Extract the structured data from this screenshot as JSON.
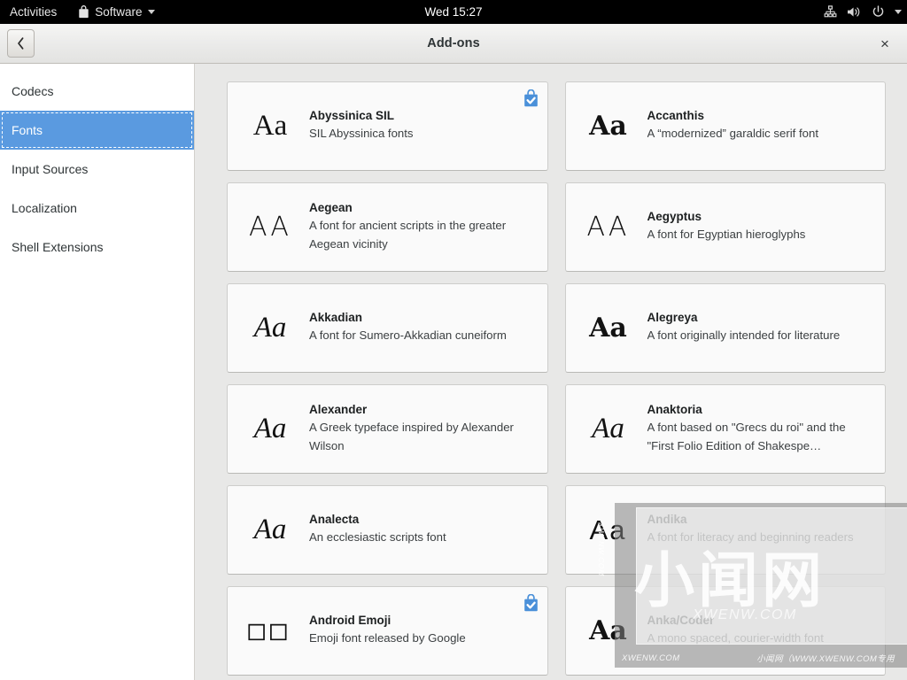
{
  "topbar": {
    "activities": "Activities",
    "app_name": "Software",
    "app_icon": "shopping-bag-icon",
    "clock": "Wed 15:27",
    "status_icons": [
      "network-wired-icon",
      "volume-icon",
      "power-icon",
      "chevron-down-icon"
    ]
  },
  "window": {
    "title": "Add-ons",
    "back_icon": "chevron-left-icon",
    "back_glyph": "‹",
    "close_icon": "close-icon",
    "close_glyph": "×"
  },
  "sidebar": {
    "selected": "Fonts",
    "items": [
      {
        "label": "Codecs"
      },
      {
        "label": "Fonts"
      },
      {
        "label": "Input Sources"
      },
      {
        "label": "Localization"
      },
      {
        "label": "Shell Extensions"
      }
    ]
  },
  "cards": [
    {
      "title": "Abyssinica SIL",
      "desc": "SIL Abyssinica fonts",
      "preview": "Aa",
      "style": "pv-serif",
      "installed": true
    },
    {
      "title": "Accanthis",
      "desc": "A “modernized” garaldic serif font",
      "preview": "Aa",
      "style": "pv-bold",
      "installed": false
    },
    {
      "title": "Aegean",
      "desc": "A font for ancient scripts in the greater Aegean vicinity",
      "preview": "AA",
      "style": "pv-sansthin",
      "installed": false
    },
    {
      "title": "Aegyptus",
      "desc": "A font for Egyptian hieroglyphs",
      "preview": "AA",
      "style": "pv-sansthin",
      "installed": false
    },
    {
      "title": "Akkadian",
      "desc": "A font for Sumero-Akkadian cuneiform",
      "preview": "Aa",
      "style": "pv-italic",
      "installed": false
    },
    {
      "title": "Alegreya",
      "desc": "A font originally intended for literature",
      "preview": "Aa",
      "style": "pv-bold",
      "installed": false
    },
    {
      "title": "Alexander",
      "desc": "A Greek typeface inspired by Alexander Wilson",
      "preview": "Aa",
      "style": "pv-italic",
      "installed": false
    },
    {
      "title": "Anaktoria",
      "desc": "A font based on \"Grecs du roi\" and the \"First Folio Edition of Shakespe…",
      "preview": "Aa",
      "style": "pv-italic",
      "installed": false
    },
    {
      "title": "Analecta",
      "desc": "An ecclesiastic scripts font",
      "preview": "Aa",
      "style": "pv-italic",
      "installed": false
    },
    {
      "title": "Andika",
      "desc": "A font for literacy and beginning readers",
      "preview": "Aa",
      "style": "pv-sans",
      "installed": false
    },
    {
      "title": "Android Emoji",
      "desc": "Emoji font released by Google",
      "preview": "□□",
      "style": "pv-tofu",
      "installed": true
    },
    {
      "title": "Anka/Coder",
      "desc": "A mono spaced, courier-width font",
      "preview": "Aa",
      "style": "pv-bold",
      "installed": false
    }
  ],
  "watermark": {
    "big_text": "小闻网",
    "mid_text": "XWENW.COM",
    "vertical_text": "XWENW.COM",
    "footer_left": "XWENW.COM",
    "footer_right": "小闻网（WWW.XWENW.COM专用"
  },
  "colors": {
    "accent": "#5a9ae0",
    "badge": "#4a90d9",
    "topbar_bg": "#000000",
    "card_bg": "#fafafa",
    "content_bg": "#e8e8e7"
  }
}
